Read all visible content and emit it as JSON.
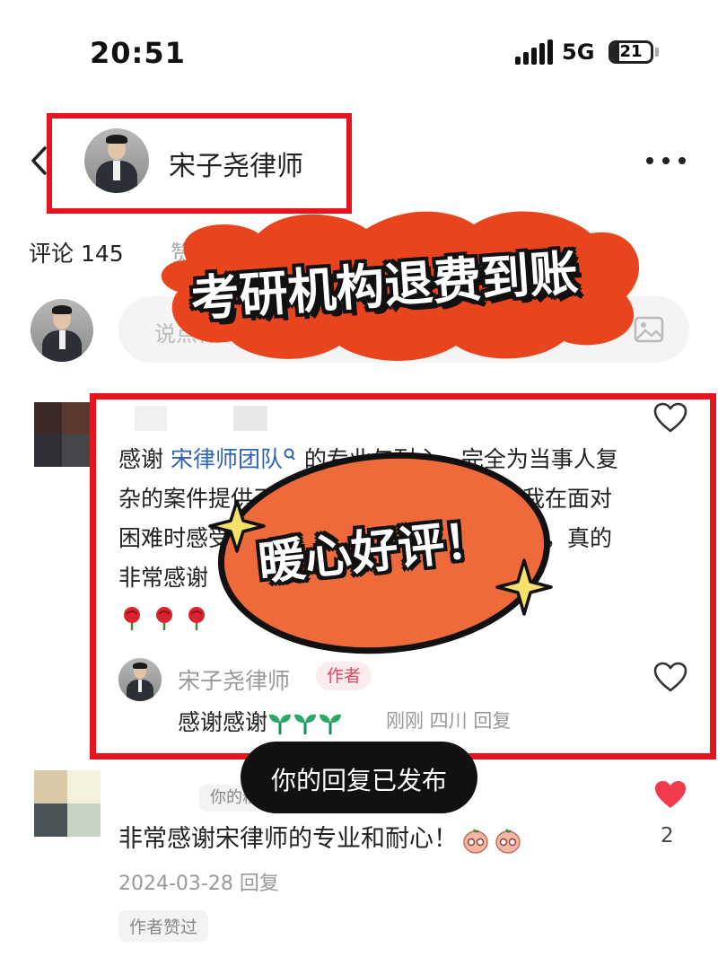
{
  "status_bar": {
    "time": "20:51",
    "network": "5G",
    "battery": "21",
    "battery_level": 0.21
  },
  "header": {
    "name": "宋子尧律师",
    "icons": [
      "back-icon",
      "avatar",
      "more-icon"
    ]
  },
  "tabs": {
    "comments": "评论 145",
    "likes": "赞和收藏"
  },
  "composer": {
    "placeholder": "说点什么...",
    "icons": [
      "at-icon",
      "emoji-icon",
      "image-icon"
    ]
  },
  "banner": {
    "text": "考研机构退费到账",
    "color": "#e8441d"
  },
  "comment_1": {
    "text_before": "感谢 ",
    "mention": "宋律师团队",
    "text_after": " 的专业与耐心，完全为当事人复杂的案件提供了细致入微的法律服务，让我在面对困难时感受到，给予了我很大的帮助和支持，真的非常感谢",
    "emoji": [
      "rose-icon",
      "rose-icon",
      "rose-icon"
    ],
    "reply": {
      "author": "宋子尧律师",
      "badge": "作者",
      "text": "感谢感谢",
      "emoji": [
        "sprout-icon",
        "sprout-icon",
        "sprout-icon"
      ],
      "meta": "刚刚 四川 回复"
    }
  },
  "sticker": {
    "text": "暖心好评！",
    "color": "#ef6a3a"
  },
  "toast": {
    "text": "你的回复已发布"
  },
  "comment_2": {
    "reply_to": "你的粉丝",
    "text": "非常感谢宋律师的专业和耐心！",
    "emoji": [
      "peach-icon",
      "peach-icon"
    ],
    "meta": "2024-03-28 回复",
    "liked_badge": "作者赞过",
    "like_count": "2"
  },
  "colors": {
    "highlight_box": "#e6141c",
    "like_red": "#ef3a4c",
    "mention_blue": "#2e63b8"
  }
}
